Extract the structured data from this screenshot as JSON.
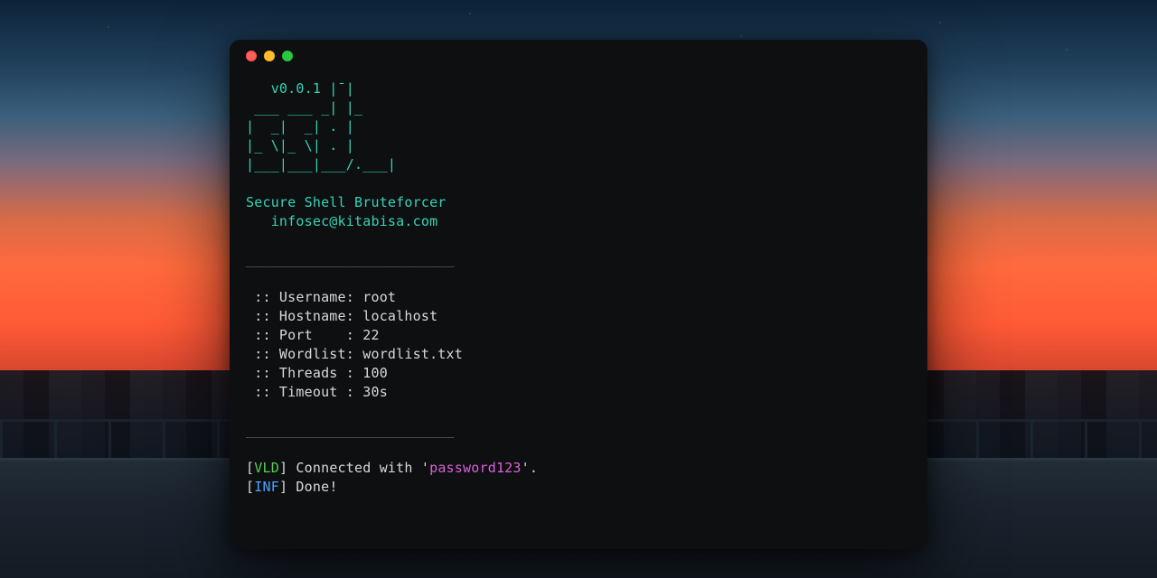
{
  "banner": {
    "ascii_lines": [
      "   v0.0.1 |¯|",
      " ___ ___ _| |_",
      "|  _|  _| . |",
      "|_ \\|_ \\| . |",
      "|___|___|___/.___|"
    ],
    "title": "Secure Shell Bruteforcer",
    "contact": "   infosec@kitabisa.com"
  },
  "rule": "_________________________",
  "params": [
    {
      "label": " :: Username: ",
      "value": "root"
    },
    {
      "label": " :: Hostname: ",
      "value": "localhost"
    },
    {
      "label": " :: Port    : ",
      "value": "22"
    },
    {
      "label": " :: Wordlist: ",
      "value": "wordlist.txt"
    },
    {
      "label": " :: Threads : ",
      "value": "100"
    },
    {
      "label": " :: Timeout : ",
      "value": "30s"
    }
  ],
  "log": {
    "vld": {
      "tag": "VLD",
      "prefix": "] Connected with '",
      "password": "password123",
      "suffix": "'."
    },
    "inf": {
      "tag": "INF",
      "text": "] Done!"
    }
  },
  "brackets": {
    "open": "[",
    "close": "]"
  }
}
